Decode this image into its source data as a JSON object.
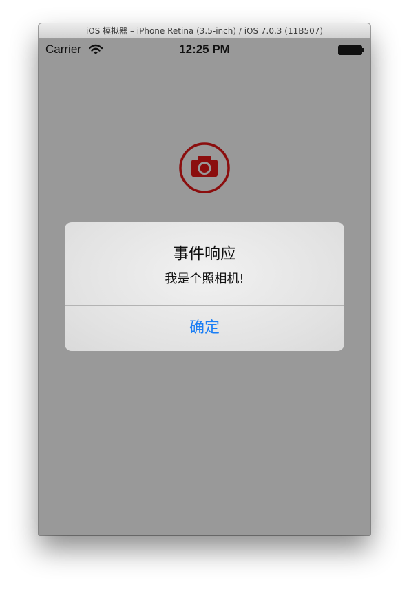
{
  "window": {
    "title": "iOS 模拟器 – iPhone Retina (3.5-inch) / iOS 7.0.3 (11B507)"
  },
  "status_bar": {
    "carrier": "Carrier",
    "time": "12:25 PM",
    "wifi_icon": "wifi-icon",
    "battery_icon": "battery-icon"
  },
  "camera_button": {
    "icon": "camera-icon",
    "color": "#8b0e0e"
  },
  "alert": {
    "title": "事件响应",
    "message": "我是个照相机!",
    "ok_label": "确定",
    "ok_color": "#1a7ef5"
  },
  "colors": {
    "screen_background": "#999999",
    "alert_background": "#e8e8e8"
  }
}
